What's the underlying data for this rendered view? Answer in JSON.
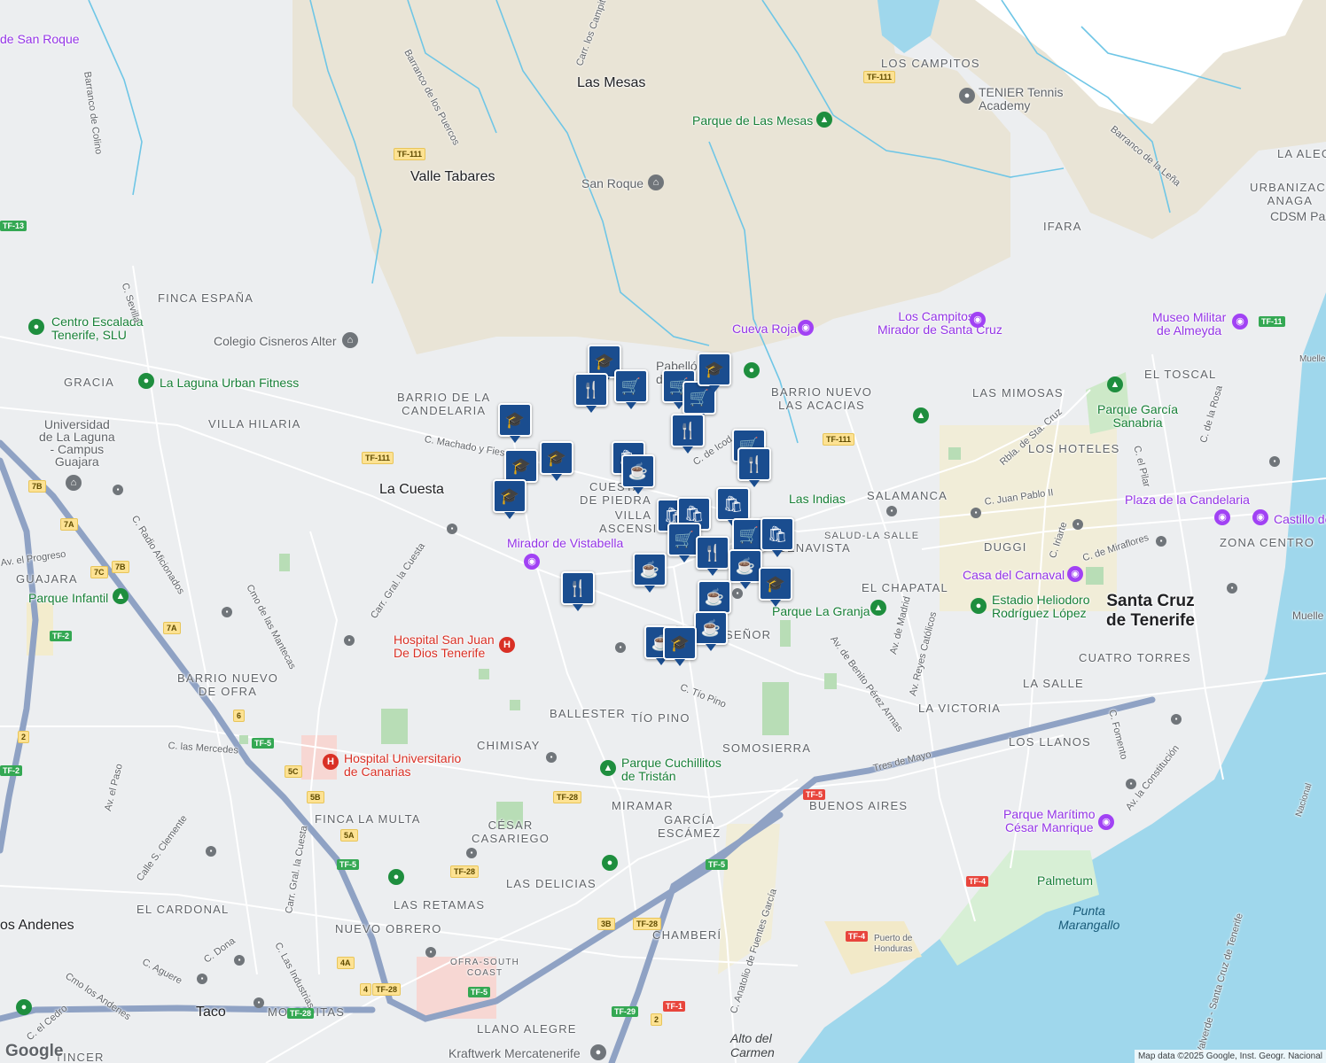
{
  "attribution": "Map data ©2025 Google, Inst. Geogr. Nacional",
  "logo": "Google",
  "neighborhoods": [
    {
      "id": "los-campitos",
      "text": "LOS CAMPITOS"
    },
    {
      "id": "ifara",
      "text": "IFARA"
    },
    {
      "id": "finca-espana",
      "text": "FINCA ESPAÑA"
    },
    {
      "id": "gracia",
      "text": "GRACIA"
    },
    {
      "id": "villa-hilaria",
      "text": "VILLA HILARIA"
    },
    {
      "id": "barrio-candelaria",
      "text": "BARRIO DE LA\nCANDELARIA"
    },
    {
      "id": "barrio-nuevo-acacias",
      "text": "BARRIO NUEVO\nLAS ACACIAS"
    },
    {
      "id": "las-mimosas",
      "text": "LAS MIMOSAS"
    },
    {
      "id": "el-toscal",
      "text": "EL TOSCAL"
    },
    {
      "id": "los-hoteles",
      "text": "LOS HOTELES"
    },
    {
      "id": "la-alegria",
      "text": "LA ALEG"
    },
    {
      "id": "urbanizacion-anaga",
      "text": "URBANIZACI\nANAGA"
    },
    {
      "id": "cuesta-piedra",
      "text": "CUESTA\nDE PIEDRA"
    },
    {
      "id": "villa-ascension",
      "text": "VILLA\nASCENSIÓ"
    },
    {
      "id": "salamanca",
      "text": "SALAMANCA"
    },
    {
      "id": "salud-la-salle",
      "text": "SALUD-LA SALLE"
    },
    {
      "id": "duggi",
      "text": "DUGGI"
    },
    {
      "id": "zona-centro",
      "text": "ZONA CENTRO"
    },
    {
      "id": "benavista",
      "text": "BENAVISTA"
    },
    {
      "id": "el-chapatal",
      "text": "EL CHAPATAL"
    },
    {
      "id": "guajara",
      "text": "GUAJARA"
    },
    {
      "id": "barrio-nuevo-ofra",
      "text": "BARRIO NUEVO\nDE OFRA"
    },
    {
      "id": "el-senor",
      "text": "SEÑOR"
    },
    {
      "id": "ballester",
      "text": "BALLESTER"
    },
    {
      "id": "tio-pino",
      "text": "TÍO PINO"
    },
    {
      "id": "chimisay",
      "text": "CHIMISAY"
    },
    {
      "id": "somosierra",
      "text": "SOMOSIERRA"
    },
    {
      "id": "cuatro-torres",
      "text": "CUATRO TORRES"
    },
    {
      "id": "la-salle",
      "text": "LA SALLE"
    },
    {
      "id": "la-victoria",
      "text": "LA VICTORIA"
    },
    {
      "id": "los-llanos",
      "text": "LOS LLANOS"
    },
    {
      "id": "buenos-aires",
      "text": "BUENOS AIRES"
    },
    {
      "id": "miramar",
      "text": "MIRAMAR"
    },
    {
      "id": "garcia-escamez",
      "text": "GARCÍA\nESCÁMEZ"
    },
    {
      "id": "finca-la-multa",
      "text": "FINCA LA MULTA"
    },
    {
      "id": "cesar-casariego",
      "text": "CÉSAR\nCASARIEGO"
    },
    {
      "id": "las-delicias",
      "text": "LAS DELICIAS"
    },
    {
      "id": "el-cardonal",
      "text": "EL CARDONAL"
    },
    {
      "id": "las-retamas",
      "text": "LAS RETAMAS"
    },
    {
      "id": "nuevo-obrero",
      "text": "NUEVO OBRERO"
    },
    {
      "id": "chamberi",
      "text": "CHAMBERÍ"
    },
    {
      "id": "moraditas",
      "text": "MORADITAS"
    },
    {
      "id": "llano-alegre",
      "text": "LLANO ALEGRE"
    },
    {
      "id": "tincer",
      "text": "TINCER"
    },
    {
      "id": "ofra-south-coast",
      "text": "OFRA-SOUTH\nCOAST"
    }
  ],
  "towns": [
    {
      "id": "las-mesas",
      "text": "Las Mesas"
    },
    {
      "id": "valle-tabares",
      "text": "Valle Tabares"
    },
    {
      "id": "la-cuesta",
      "text": "La Cuesta"
    },
    {
      "id": "los-andenes",
      "text": "os Andenes"
    },
    {
      "id": "taco",
      "text": "Taco"
    },
    {
      "id": "santa-cruz",
      "text": "Santa Cruz\nde Tenerife"
    }
  ],
  "pois": [
    {
      "id": "san-roque-top",
      "text": "de San Roque",
      "color": "purple"
    },
    {
      "id": "tenier",
      "text": "TENIER Tennis\nAcademy",
      "color": "gray"
    },
    {
      "id": "parque-mesas",
      "text": "Parque de Las Mesas",
      "color": "green"
    },
    {
      "id": "san-roque",
      "text": "San Roque",
      "color": "gray"
    },
    {
      "id": "cdsm",
      "text": "CDSM Pas",
      "color": "gray"
    },
    {
      "id": "centro-escalada",
      "text": "Centro Escalada\nTenerife, SLU",
      "color": "green"
    },
    {
      "id": "colegio-cisneros",
      "text": "Colegio Cisneros Alter",
      "color": "gray"
    },
    {
      "id": "cueva-roja",
      "text": "Cueva Roja",
      "color": "purple"
    },
    {
      "id": "los-campitos-mirador",
      "text": "Los Campitos -\nMirador de Santa Cruz",
      "color": "purple"
    },
    {
      "id": "museo-militar",
      "text": "Museo Militar\nde Almeyda",
      "color": "purple"
    },
    {
      "id": "laguna-fitness",
      "text": "La Laguna Urban Fitness",
      "color": "green"
    },
    {
      "id": "pabellon",
      "text": "Pabellón Mu\nd",
      "color": "gray"
    },
    {
      "id": "parque-garcia-sanabria",
      "text": "Parque García\nSanabria",
      "color": "green"
    },
    {
      "id": "universidad",
      "text": "Universidad\nde La Laguna\n- Campus\nGuajara",
      "color": "gray"
    },
    {
      "id": "las-indias",
      "text": "Las Indias",
      "color": "green"
    },
    {
      "id": "plaza-candelaria",
      "text": "Plaza de la Candelaria",
      "color": "purple"
    },
    {
      "id": "castillo",
      "text": "Castillo de",
      "color": "purple"
    },
    {
      "id": "mirador-vistabella",
      "text": "Mirador de Vistabella",
      "color": "purple"
    },
    {
      "id": "casa-carnaval",
      "text": "Casa del Carnaval",
      "color": "purple"
    },
    {
      "id": "estadio",
      "text": "Estadio Heliodoro\nRodríguez López",
      "color": "green"
    },
    {
      "id": "parque-infantil",
      "text": "Parque Infantil",
      "color": "green"
    },
    {
      "id": "parque-la-granja",
      "text": "Parque La Granja",
      "color": "green"
    },
    {
      "id": "hospital-san-juan",
      "text": "Hospital San Juan\nDe Dios Tenerife",
      "color": "red"
    },
    {
      "id": "hospital-universitario",
      "text": "Hospital Universitario\nde Canarias",
      "color": "red"
    },
    {
      "id": "parque-cuchillitos",
      "text": "Parque Cuchillitos\nde Tristán",
      "color": "green"
    },
    {
      "id": "parque-maritimo",
      "text": "Parque Marítimo\nCésar Manrique",
      "color": "purple"
    },
    {
      "id": "palmetum",
      "text": "Palmetum",
      "color": "green"
    },
    {
      "id": "kraftwerk",
      "text": "Kraftwerk Mercatenerife",
      "color": "gray"
    },
    {
      "id": "muelle-sur",
      "text": "Muelle Sur",
      "color": "gray"
    },
    {
      "id": "muelle-norte",
      "text": "Muelle",
      "color": "gray"
    },
    {
      "id": "puerto-honduras",
      "text": "Puerto de\nHonduras",
      "color": "gray"
    }
  ],
  "water_labels": [
    {
      "id": "punta-marangallo",
      "text": "Punta\nMarangallo"
    },
    {
      "id": "alto-carmen",
      "text": "Alto del\nCarmen"
    }
  ],
  "streets": [
    {
      "id": "barranco-san-roque",
      "text": "Barranco de San Roque"
    },
    {
      "id": "barranco-los-puercos",
      "text": "Barranco de los Puercos"
    },
    {
      "id": "barranco-la-lena",
      "text": "Barranco de la Leña"
    },
    {
      "id": "carr-campitos",
      "text": "Carr. los Campitos"
    },
    {
      "id": "c-sevilla",
      "text": "C. Sevilla"
    },
    {
      "id": "c-machado",
      "text": "C. Machado y Fiesta"
    },
    {
      "id": "c-icod",
      "text": "C. de Icod"
    },
    {
      "id": "c-m",
      "text": "C. M"
    },
    {
      "id": "rbla-sta-cruz",
      "text": "Rbla. de Sta. Cruz"
    },
    {
      "id": "c-juan-pablo",
      "text": "C. Juan Pablo II"
    },
    {
      "id": "c-iriarte",
      "text": "C. Iriarte"
    },
    {
      "id": "c-miraflores",
      "text": "C. de Miraflores"
    },
    {
      "id": "c-el-pilar",
      "text": "C. el Pilar"
    },
    {
      "id": "c-rosa",
      "text": "C. de la Rosa"
    },
    {
      "id": "cmo-mantecas",
      "text": "Cmo de las Mantecas"
    },
    {
      "id": "c-radio-aficionados",
      "text": "C. Radio Aficionados"
    },
    {
      "id": "av-progreso",
      "text": "Av. el Progreso"
    },
    {
      "id": "carr-gral-cuesta",
      "text": "Carr. Gral. la Cuesta"
    },
    {
      "id": "av-madrid",
      "text": "Av. de Madrid"
    },
    {
      "id": "av-reyes-catolicos",
      "text": "Av. Reyes Católicos"
    },
    {
      "id": "av-benito-perez",
      "text": "Av. de Benito Pérez Armas"
    },
    {
      "id": "c-tio-pino",
      "text": "C. Tío Pino"
    },
    {
      "id": "tres-de-mayo",
      "text": "Tres de Mayo"
    },
    {
      "id": "c-fomento",
      "text": "C. Fomento"
    },
    {
      "id": "av-constitucion",
      "text": "Av. la Constitución"
    },
    {
      "id": "c-las-mercedes",
      "text": "C. las Mercedes"
    },
    {
      "id": "av-el-paso",
      "text": "Av. el Paso"
    },
    {
      "id": "calle-s-clemente",
      "text": "Calle S. Clemente"
    },
    {
      "id": "carr-gral-cuesta-2",
      "text": "Carr. Gral. la Cuesta"
    },
    {
      "id": "c-dona",
      "text": "C. Dona"
    },
    {
      "id": "c-las-industrias",
      "text": "C. Las Industrias"
    },
    {
      "id": "c-aguere",
      "text": "C. Aguere"
    },
    {
      "id": "cmo-los-andenes",
      "text": "Cmo los Andenes"
    },
    {
      "id": "c-el-cedro",
      "text": "C. el Cedro"
    },
    {
      "id": "c-anatolio",
      "text": "C. Anatolio de Fuentes García"
    },
    {
      "id": "valverde-tenerife",
      "text": "Valverde - Santa Cruz de Tenerife"
    },
    {
      "id": "barranco-colino",
      "text": "Barranco de Colino"
    },
    {
      "id": "c-nacional",
      "text": "Nacional"
    }
  ],
  "highway_shields": [
    {
      "id": "tf111-a",
      "text": "TF-111",
      "style": "y"
    },
    {
      "id": "tf111-b",
      "text": "TF-111",
      "style": "y"
    },
    {
      "id": "tf111-c",
      "text": "TF-111",
      "style": "y"
    },
    {
      "id": "tf111-d",
      "text": "TF-111",
      "style": "y"
    },
    {
      "id": "tf13",
      "text": "TF-13",
      "style": "g"
    },
    {
      "id": "tf11",
      "text": "TF-11",
      "style": "g"
    },
    {
      "id": "tf2-a",
      "text": "TF-2",
      "style": "g"
    },
    {
      "id": "tf2-b",
      "text": "TF-2",
      "style": "g"
    },
    {
      "id": "tf5-a",
      "text": "TF-5",
      "style": "g"
    },
    {
      "id": "tf5-b",
      "text": "TF-5",
      "style": "r"
    },
    {
      "id": "tf5-c",
      "text": "TF-5",
      "style": "g"
    },
    {
      "id": "tf5-d",
      "text": "TF-5",
      "style": "g"
    },
    {
      "id": "tf5-e",
      "text": "TF-5",
      "style": "g"
    },
    {
      "id": "tf28-a",
      "text": "TF-28",
      "style": "y"
    },
    {
      "id": "tf28-b",
      "text": "TF-28",
      "style": "y"
    },
    {
      "id": "tf28-c",
      "text": "TF-28",
      "style": "y"
    },
    {
      "id": "tf28-d",
      "text": "TF-28",
      "style": "y"
    },
    {
      "id": "tf28-e",
      "text": "TF-28",
      "style": "g"
    },
    {
      "id": "tf29",
      "text": "TF-29",
      "style": "g"
    },
    {
      "id": "tf1",
      "text": "TF-1",
      "style": "r"
    },
    {
      "id": "tf4-a",
      "text": "TF-4",
      "style": "r"
    },
    {
      "id": "tf4-b",
      "text": "TF-4",
      "style": "r"
    },
    {
      "id": "x7b-a",
      "text": "7B",
      "style": "y"
    },
    {
      "id": "x7a-a",
      "text": "7A",
      "style": "y"
    },
    {
      "id": "x7b-b",
      "text": "7B",
      "style": "y"
    },
    {
      "id": "x7c",
      "text": "7C",
      "style": "y"
    },
    {
      "id": "x7a-b",
      "text": "7A",
      "style": "y"
    },
    {
      "id": "x6",
      "text": "6",
      "style": "y"
    },
    {
      "id": "x2",
      "text": "2",
      "style": "y"
    },
    {
      "id": "x5c",
      "text": "5C",
      "style": "y"
    },
    {
      "id": "x5b",
      "text": "5B",
      "style": "y"
    },
    {
      "id": "x5a",
      "text": "5A",
      "style": "y"
    },
    {
      "id": "x4a",
      "text": "4A",
      "style": "y"
    },
    {
      "id": "x4",
      "text": "4",
      "style": "y"
    },
    {
      "id": "x3b",
      "text": "3B",
      "style": "y"
    },
    {
      "id": "x2b",
      "text": "2",
      "style": "y"
    }
  ],
  "markers": [
    {
      "id": "m1",
      "type": "school",
      "icon": "🎓"
    },
    {
      "id": "m2",
      "type": "restaurant",
      "icon": "🍴"
    },
    {
      "id": "m3",
      "type": "grocery",
      "icon": "🛒"
    },
    {
      "id": "m4",
      "type": "grocery",
      "icon": "🛒"
    },
    {
      "id": "m5",
      "type": "grocery",
      "icon": "🛒"
    },
    {
      "id": "m6",
      "type": "school",
      "icon": "🎓"
    },
    {
      "id": "m7",
      "type": "school",
      "icon": "🎓"
    },
    {
      "id": "m8",
      "type": "school",
      "icon": "🎓"
    },
    {
      "id": "m9",
      "type": "school",
      "icon": "🎓"
    },
    {
      "id": "m10",
      "type": "school",
      "icon": "🎓"
    },
    {
      "id": "m11",
      "type": "restaurant",
      "icon": "🍴"
    },
    {
      "id": "m12",
      "type": "shopping",
      "icon": "🛍"
    },
    {
      "id": "m13",
      "type": "cafe",
      "icon": "☕"
    },
    {
      "id": "m14",
      "type": "grocery",
      "icon": "🛒"
    },
    {
      "id": "m15",
      "type": "restaurant",
      "icon": "🍴"
    },
    {
      "id": "m16",
      "type": "shopping",
      "icon": "🛍"
    },
    {
      "id": "m17",
      "type": "shopping",
      "icon": "🛍"
    },
    {
      "id": "m18",
      "type": "shopping",
      "icon": "🛍"
    },
    {
      "id": "m19",
      "type": "grocery",
      "icon": "🛒"
    },
    {
      "id": "m20",
      "type": "grocery",
      "icon": "🛒"
    },
    {
      "id": "m21",
      "type": "restaurant",
      "icon": "🍴"
    },
    {
      "id": "m22",
      "type": "shopping",
      "icon": "🛍"
    },
    {
      "id": "m23",
      "type": "cafe",
      "icon": "☕"
    },
    {
      "id": "m24",
      "type": "cafe",
      "icon": "☕"
    },
    {
      "id": "m25",
      "type": "school",
      "icon": "🎓"
    },
    {
      "id": "m26",
      "type": "restaurant",
      "icon": "🍴"
    },
    {
      "id": "m27",
      "type": "cafe",
      "icon": "☕"
    },
    {
      "id": "m28",
      "type": "cafe",
      "icon": "☕"
    },
    {
      "id": "m29",
      "type": "cafe",
      "icon": "☕"
    },
    {
      "id": "m30",
      "type": "school",
      "icon": "🎓"
    }
  ]
}
